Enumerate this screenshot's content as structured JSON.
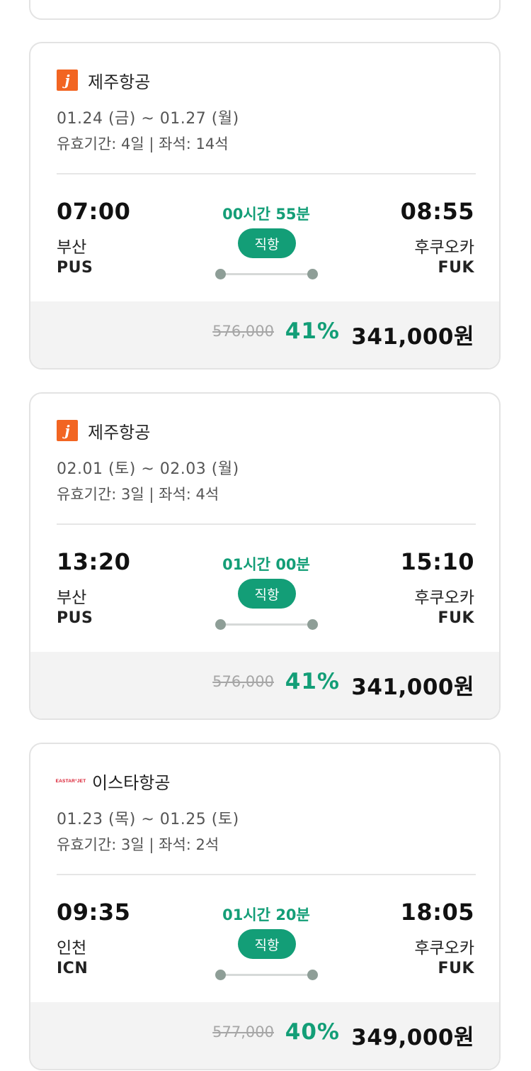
{
  "colors": {
    "accent_green": "#139e77",
    "jeju_orange": "#f26522",
    "eastar_red": "#d8162a",
    "price_bar_bg": "#f3f3f3"
  },
  "flights": [
    {
      "airline": "제주항공",
      "logo": "jeju-air-logo",
      "logo_text": "j",
      "dates": "01.24 (금) ~ 01.27 (월)",
      "validity": "유효기간: 4일 | 좌석: 14석",
      "departure": {
        "time": "07:00",
        "city": "부산",
        "code": "PUS"
      },
      "arrival": {
        "time": "08:55",
        "city": "후쿠오카",
        "code": "FUK"
      },
      "duration": "00시간 55분",
      "flight_type": "직항",
      "original_price": "576,000",
      "discount": "41%",
      "final_price": "341,000원"
    },
    {
      "airline": "제주항공",
      "logo": "jeju-air-logo",
      "logo_text": "j",
      "dates": "02.01 (토) ~ 02.03 (월)",
      "validity": "유효기간: 3일 | 좌석: 4석",
      "departure": {
        "time": "13:20",
        "city": "부산",
        "code": "PUS"
      },
      "arrival": {
        "time": "15:10",
        "city": "후쿠오카",
        "code": "FUK"
      },
      "duration": "01시간 00분",
      "flight_type": "직항",
      "original_price": "576,000",
      "discount": "41%",
      "final_price": "341,000원"
    },
    {
      "airline": "이스타항공",
      "logo": "eastar-jet-logo",
      "logo_text": "EASTAR°JET",
      "dates": "01.23 (목) ~ 01.25 (토)",
      "validity": "유효기간: 3일 | 좌석: 2석",
      "departure": {
        "time": "09:35",
        "city": "인천",
        "code": "ICN"
      },
      "arrival": {
        "time": "18:05",
        "city": "후쿠오카",
        "code": "FUK"
      },
      "duration": "01시간 20분",
      "flight_type": "직항",
      "original_price": "577,000",
      "discount": "40%",
      "final_price": "349,000원"
    }
  ]
}
